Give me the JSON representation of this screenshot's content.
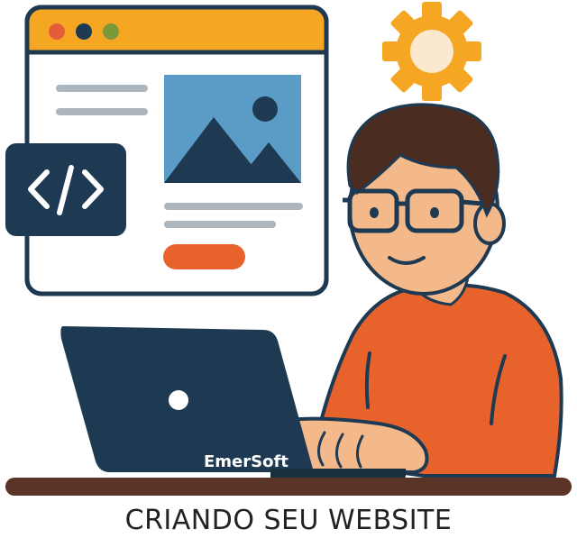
{
  "caption": "CRIANDO SEU WEBSITE",
  "laptop": {
    "brand": "EmerSoft"
  },
  "icons": {
    "code": "code-brackets-icon",
    "settings": "gear-icon",
    "image": "image-placeholder-icon"
  },
  "colors": {
    "navy": "#1e3a52",
    "window_header": "#f5a623",
    "orange": "#e8622c",
    "gear": "#f5a623",
    "image_bg": "#5b9cc6",
    "skin": "#f4b98a",
    "hair": "#4a2c20",
    "desk": "#5a3426"
  }
}
